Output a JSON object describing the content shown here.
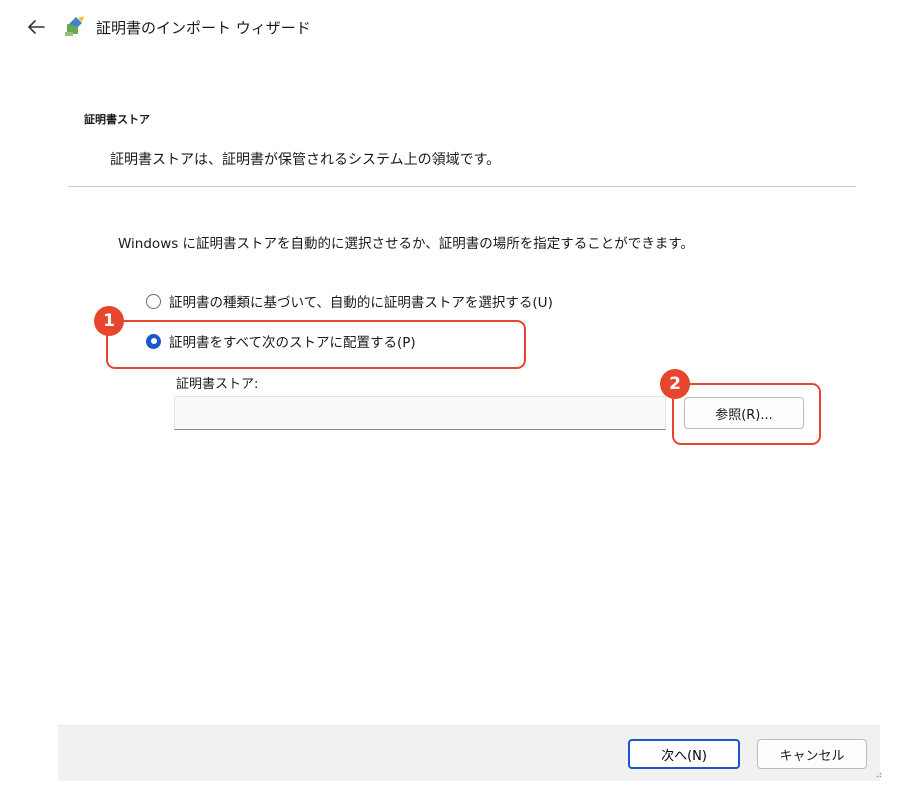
{
  "window": {
    "title": "証明書のインポート ウィザード"
  },
  "section": {
    "heading": "証明書ストア",
    "description": "証明書ストアは、証明書が保管されるシステム上の領域です。"
  },
  "intro": "Windows に証明書ストアを自動的に選択させるか、証明書の場所を指定することができます。",
  "options": [
    {
      "label": "証明書の種類に基づいて、自動的に証明書ストアを選択する(U)",
      "selected": false
    },
    {
      "label": "証明書をすべて次のストアに配置する(P)",
      "selected": true
    }
  ],
  "store": {
    "label": "証明書ストア:",
    "value": ""
  },
  "buttons": {
    "browse": "参照(R)...",
    "next": "次へ(N)",
    "cancel": "キャンセル"
  },
  "callouts": [
    "1",
    "2"
  ],
  "colors": {
    "accent": "#1a57c8",
    "callout": "#e8452e"
  }
}
